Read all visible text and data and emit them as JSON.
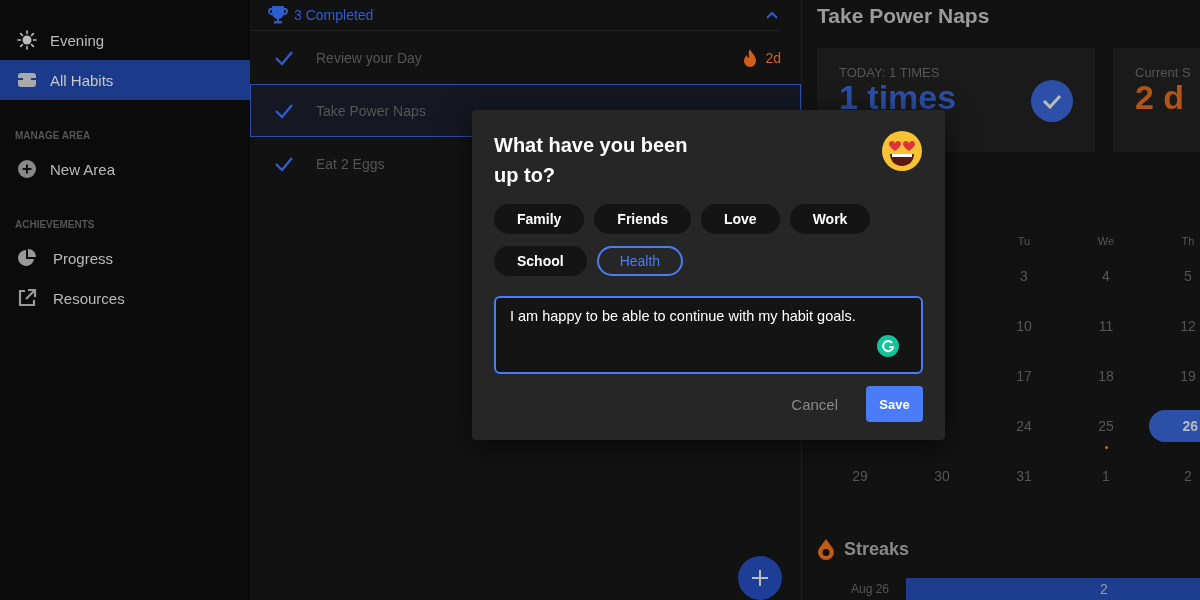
{
  "sidebar": {
    "items": [
      {
        "kind": "item",
        "label": "Evening",
        "selected": false
      },
      {
        "kind": "item",
        "label": "All Habits",
        "selected": true
      },
      {
        "kind": "heading",
        "label": "MANAGE AREA"
      },
      {
        "kind": "item",
        "label": "New Area",
        "selected": false
      },
      {
        "kind": "heading",
        "label": "ACHIEVEMENTS"
      },
      {
        "kind": "item",
        "label": "Progress",
        "selected": false
      },
      {
        "kind": "item",
        "label": "Resources",
        "selected": false
      }
    ]
  },
  "habit_list": {
    "header": {
      "label": "3 Completed",
      "expanded": true
    },
    "habits": [
      {
        "name": "Review your Day",
        "done": true,
        "selected": false,
        "streak": "2d"
      },
      {
        "name": "Take Power Naps",
        "done": true,
        "selected": true
      },
      {
        "name": "Eat 2 Eggs",
        "done": true,
        "selected": false
      }
    ]
  },
  "detail": {
    "title": "Take Power Naps",
    "cards": [
      {
        "label": "TODAY: 1 TIMES",
        "value": "1 times",
        "done": true,
        "color": "#2c4fa8"
      },
      {
        "label": "Current S",
        "value": "2 d",
        "color": "#b35416"
      }
    ],
    "calendar": {
      "weekdays": [
        "Tu",
        "We",
        "Th"
      ],
      "weeks": [
        [
          {
            "day": "3",
            "selected": false,
            "marked": false
          },
          {
            "day": "4",
            "selected": false,
            "marked": false
          },
          {
            "day": "5",
            "selected": false,
            "marked": false
          }
        ],
        [
          {
            "day": "10",
            "selected": false,
            "marked": false
          },
          {
            "day": "11",
            "selected": false,
            "marked": false
          },
          {
            "day": "12",
            "selected": false,
            "marked": false
          }
        ],
        [
          {
            "day": "17",
            "selected": false,
            "marked": false
          },
          {
            "day": "18",
            "selected": false,
            "marked": false
          },
          {
            "day": "19",
            "selected": false,
            "marked": false
          }
        ],
        [
          {
            "day": "24",
            "selected": false,
            "marked": false
          },
          {
            "day": "25",
            "selected": false,
            "marked": true
          },
          {
            "day": "26",
            "selected": true,
            "marked": false
          }
        ],
        [
          {
            "day": "29",
            "selected": false,
            "marked": false
          },
          {
            "day": "30",
            "selected": false,
            "marked": false
          },
          {
            "day": "31",
            "selected": false,
            "marked": false
          },
          {
            "day": "1",
            "selected": false,
            "marked": false
          },
          {
            "day": "2",
            "selected": false,
            "marked": false
          }
        ]
      ]
    },
    "streaks": {
      "title": "Streaks",
      "rows": [
        {
          "date": "Aug 26",
          "count": "2"
        }
      ]
    }
  },
  "dialog": {
    "title": "What have you been up to?",
    "tags": [
      {
        "label": "Family",
        "selected": false
      },
      {
        "label": "Friends",
        "selected": false
      },
      {
        "label": "Love",
        "selected": false
      },
      {
        "label": "Work",
        "selected": false
      },
      {
        "label": "School",
        "selected": false
      },
      {
        "label": "Health",
        "selected": true
      }
    ],
    "note": {
      "value": "I am happy to be able to continue with my habit goals."
    },
    "buttons": [
      {
        "label": "Cancel",
        "kind": "text"
      },
      {
        "label": "Save",
        "kind": "primary"
      }
    ]
  }
}
